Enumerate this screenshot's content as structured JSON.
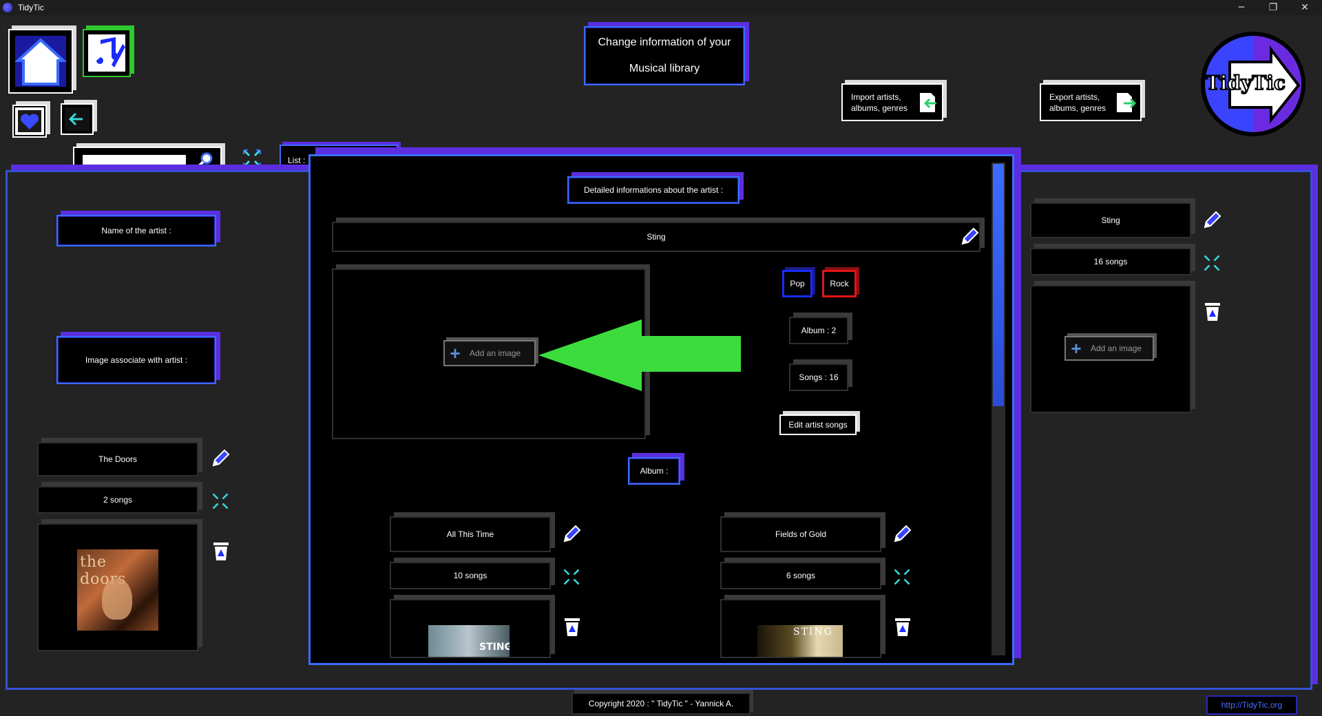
{
  "window": {
    "title": "TidyTic",
    "minimize": "─",
    "restore": "❐",
    "close": "✕"
  },
  "header": {
    "page_title_line1": "Change information of your",
    "page_title_line2": "Musical library",
    "import_label_line1": "Import artists,",
    "import_label_line2": "albums, genres",
    "export_label_line1": "Export artists,",
    "export_label_line2": "albums, genres",
    "logo_text": "TidyTic"
  },
  "search": {
    "placeholder": ""
  },
  "list_tab": {
    "label": "List :"
  },
  "left_panel": {
    "name_label": "Name of the artist :",
    "image_label": "Image associate with artist :",
    "artist_name": "The Doors",
    "artist_songs": "2 songs",
    "cover_text": "the doors"
  },
  "dialog": {
    "header": "Detailed informations about the artist :",
    "artist_name": "Sting",
    "add_image": "Add an image",
    "genres": [
      "Pop",
      "Rock"
    ],
    "album_count": "Album  : 2",
    "songs_count": "Songs  : 16",
    "edit_songs": "Edit artist songs",
    "album_header": "Album  :",
    "albums": [
      {
        "name": "All This Time",
        "songs": "10 songs",
        "cover_text": "STING"
      },
      {
        "name": "Fields of Gold",
        "songs": "6 songs",
        "cover_text": "STING"
      }
    ]
  },
  "right_panel": {
    "artist_name": "Sting",
    "artist_songs": "16 songs",
    "add_image": "Add an image"
  },
  "footer": {
    "copyright": "Copyright 2020 : \" TidyTic \" - Yannick A.",
    "website": "http://TidyTic.org"
  },
  "colors": {
    "accent_blue": "#3a6cff",
    "accent_purple": "#5b2ee0",
    "arrow_green": "#3ddc3d",
    "genre_pop": "#1a2cff",
    "genre_rock": "#e01616"
  }
}
